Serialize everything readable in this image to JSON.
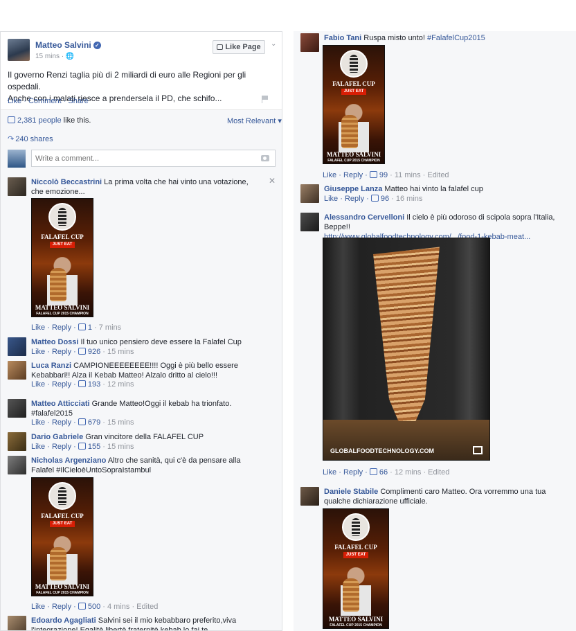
{
  "post": {
    "author": "Matteo Salvini",
    "verified_mark": "✓",
    "time": "15 mins · 🌐",
    "like_page_label": "Like Page",
    "text_line1": "Il governo Renzi taglia più di 2 miliardi di euro alle Regioni per gli ospedali.",
    "text_line2": "Anche con i malati riesce a prendersela il PD, che schifo...",
    "actions": "Like · Comment · Share",
    "likes_count": "2,381 people",
    "likes_suffix": " like this.",
    "sort_label": "Most Relevant ▾",
    "shares": "240 shares",
    "comment_placeholder": "Write a comment..."
  },
  "promo_image": {
    "title": "FALAFEL CUP",
    "badge": "JUST EAT",
    "name": "MATTEO SALVINI",
    "subtitle": "FALAFEL CUP 2015 CHAMPION"
  },
  "kebab_photo": {
    "watermark": "GLOBALFOODTECHNOLOGY.COM"
  },
  "left_comments": [
    {
      "name": "Niccolò Beccastrini",
      "text": "La prima volta che hai vinto una votazione, che emozione...",
      "meta": "Like · Reply · ",
      "likes": "1",
      "time": " · 7 mins"
    },
    {
      "name": "Matteo Dossi",
      "text": "Il tuo unico pensiero deve essere la Falafel Cup",
      "meta": "Like · Reply · ",
      "likes": "926",
      "time": " · 15 mins"
    },
    {
      "name": "Luca Ranzi",
      "text": "CAMPIONEEEEEEEE!!!! Oggi è più bello essere Kebabbari!! Alza il Kebab Matteo! Alzalo dritto al cielo!!!",
      "meta": "Like · Reply · ",
      "likes": "193",
      "time": " · 12 mins"
    },
    {
      "name": "Matteo Atticciati",
      "text": "Grande Matteo!Oggi il kebab ha trionfato. #falafel2015",
      "meta": "Like · Reply · ",
      "likes": "679",
      "time": " · 15 mins"
    },
    {
      "name": "Dario Gabriele",
      "text": "Gran vincitore della FALAFEL CUP",
      "meta": "Like · Reply · ",
      "likes": "155",
      "time": " · 15 mins"
    },
    {
      "name": "Nicholas Argenziano",
      "text": "Altro che sanità, qui c'è da pensare alla Falafel #IlCieloèUntoSopraIstambul",
      "meta": "Like · Reply · ",
      "likes": "500",
      "time": " · 4 mins · Edited"
    },
    {
      "name": "Edoardo Agagliati",
      "text": "Salvini sei il mio kebabbaro preferito,viva l'integrazione! Egalitè libertè fraternitè kebab lo fai te"
    }
  ],
  "right_comments": [
    {
      "name": "Fabio Tani",
      "text": "Ruspa misto unto! ",
      "hashtag": "#FalafelCup2015",
      "meta": "Like · Reply · ",
      "likes": "99",
      "time": " · 11 mins · Edited"
    },
    {
      "name": "Giuseppe Lanza",
      "text": "Matteo hai vinto la falafel cup",
      "meta": "Like · Reply · ",
      "likes": "96",
      "time": " · 16 mins"
    },
    {
      "name": "Alessandro Cervelloni",
      "text": "Il cielo è più odoroso di scipola sopra l'Italia, Beppe!!",
      "link": "http://www.globalfoodtechnology.com/.../food-1-kebab-meat...",
      "meta": "Like · Reply · ",
      "likes": "66",
      "time": " · 12 mins · Edited"
    },
    {
      "name": "Daniele Stabile",
      "text": "Complimenti caro Matteo. Ora vorremmo una tua qualche dichiarazione ufficiale."
    }
  ],
  "colors": {
    "link": "#365899",
    "meta_grey": "#90949c",
    "panel_bg": "#f6f7f9",
    "badge_red": "#d81e05"
  },
  "icons": [
    "thumbs-up-icon",
    "share-arrow-icon",
    "camera-icon",
    "flag-icon",
    "close-icon",
    "verified-icon",
    "chevron-down-icon",
    "exit-share-icon"
  ]
}
